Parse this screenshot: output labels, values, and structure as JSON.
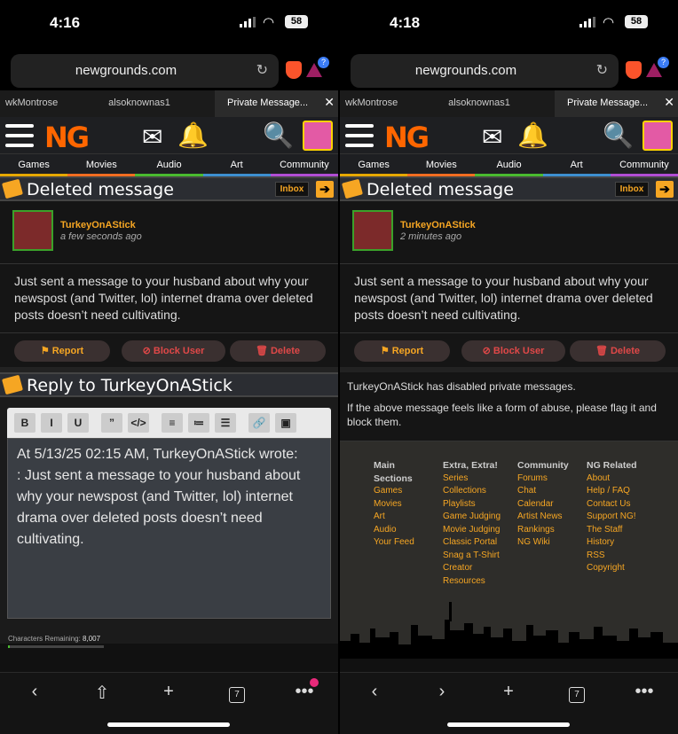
{
  "left": {
    "status": {
      "time": "4:16",
      "battery": "58"
    },
    "url": "newgrounds.com",
    "tabs": [
      "wkMontrose",
      "alsoknownas1",
      "Private Message..."
    ],
    "ng_logo": "NG",
    "categories": [
      "Games",
      "Movies",
      "Audio",
      "Art",
      "Community"
    ],
    "header": {
      "title": "Deleted message",
      "inbox": "Inbox",
      "arrow": "➔"
    },
    "sender": {
      "name": "TurkeyOnAStick",
      "ago": "a few seconds ago"
    },
    "message": "Just sent a message to your husband about why your newspost (and Twitter, lol) internet drama over deleted posts doesn’t need cultivating.",
    "actions": {
      "report": "⚑ Report",
      "block": "⊘ Block User",
      "delete": "🗑 Delete"
    },
    "reply_title": "Reply to TurkeyOnAStick",
    "toolbar": [
      "B",
      "I",
      "U",
      "”",
      "</>",
      "≡",
      "≔",
      "☰",
      "🔗",
      "▣"
    ],
    "editor_line1": "At 5/13/25 02:15 AM, TurkeyOnAStick wrote:",
    "editor_line2": ": Just sent a message to your husband about why your newspost (and Twitter, lol) internet drama over deleted posts doesn’t need cultivating.",
    "chars_label": "Characters Remaining:",
    "chars_value": "8,007",
    "chars_fraction": 0.02,
    "tab_count": "7"
  },
  "right": {
    "status": {
      "time": "4:18",
      "battery": "58"
    },
    "url": "newgrounds.com",
    "tabs": [
      "wkMontrose",
      "alsoknownas1",
      "Private Message..."
    ],
    "ng_logo": "NG",
    "categories": [
      "Games",
      "Movies",
      "Audio",
      "Art",
      "Community"
    ],
    "header": {
      "title": "Deleted message",
      "inbox": "Inbox",
      "arrow": "➔"
    },
    "sender": {
      "name": "TurkeyOnAStick",
      "ago": "2 minutes ago"
    },
    "message": "Just sent a message to your husband about why your newspost (and Twitter, lol) internet drama over deleted posts doesn’t need cultivating.",
    "actions": {
      "report": "⚑ Report",
      "block": "⊘ Block User",
      "delete": "🗑 Delete"
    },
    "disabled_1": "TurkeyOnAStick has disabled private messages.",
    "disabled_2": "If the above message feels like a form of abuse, please flag it and block them.",
    "footer": {
      "col1": {
        "head": "Main Sections",
        "links": [
          "Games",
          "Movies",
          "Art",
          "Audio",
          "Your Feed"
        ]
      },
      "col2": {
        "head": "Extra, Extra!",
        "links": [
          "Series",
          "Collections",
          "Playlists",
          "Game Judging",
          "Movie Judging",
          "Classic Portal",
          "Snag a T-Shirt",
          "Creator Resources"
        ]
      },
      "col3": {
        "head": "Community",
        "links": [
          "Forums",
          "Chat",
          "Calendar",
          "Artist News",
          "Rankings",
          "NG Wiki"
        ]
      },
      "col4": {
        "head": "NG Related",
        "links": [
          "About",
          "Help / FAQ",
          "Contact Us",
          "Support NG!",
          "The Staff",
          "History",
          "RSS",
          "Copyright"
        ]
      }
    },
    "tab_count": "7"
  },
  "colors": {
    "ng_orange": "#f6a623",
    "danger": "#e04848",
    "bg": "#151515"
  },
  "icons": [
    "hamburger-icon",
    "envelope-icon",
    "bell-icon",
    "search-icon",
    "reload-icon",
    "brave-lion-icon",
    "bat-triangle-icon",
    "flag-icon",
    "block-icon",
    "trash-icon",
    "back-icon",
    "forward-icon",
    "share-icon",
    "plus-icon",
    "tabs-icon",
    "more-icon"
  ]
}
